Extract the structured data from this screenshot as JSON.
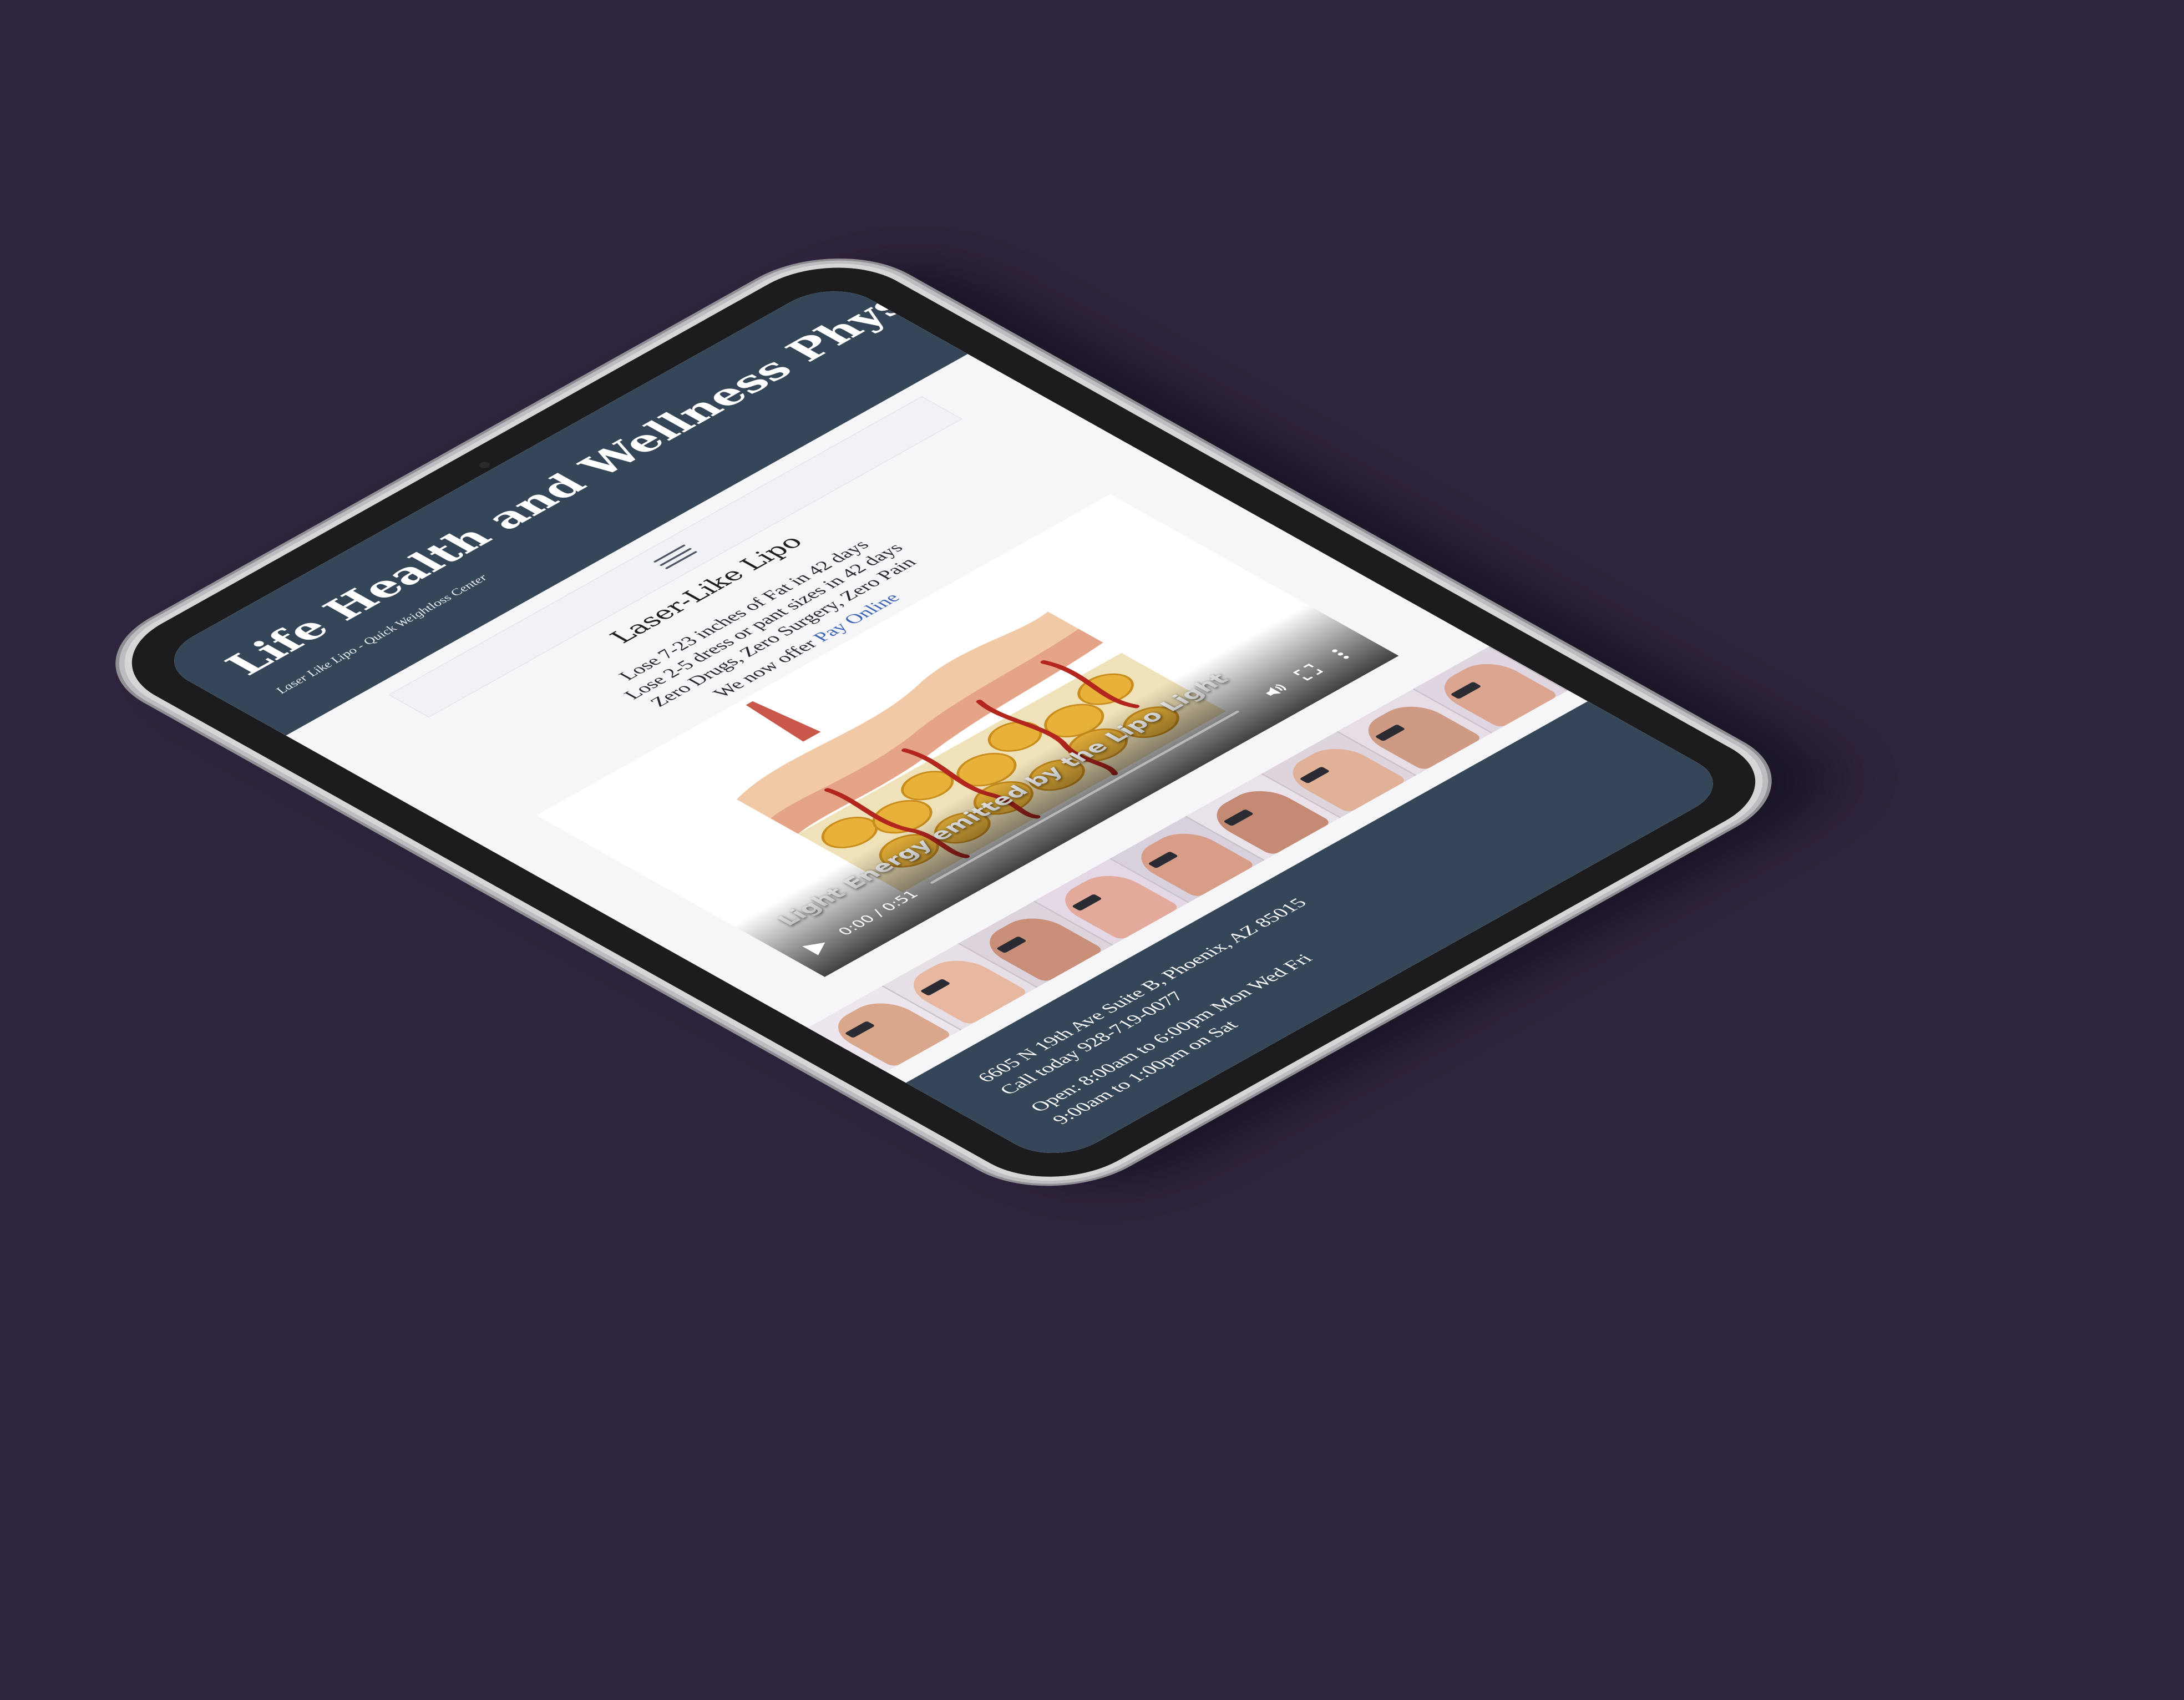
{
  "site": {
    "title": "Life Health and Wellness Physique",
    "tagline": "Laser Like Lipo - Quick Weightloss Center"
  },
  "content": {
    "heading": "Laser-Like Lipo",
    "lines": [
      "Lose 7-23 inches of Fat in 42 days",
      "Lose 2-5 dress or pant sizes in 42 days",
      "Zero Drugs,  Zero Surgery,  Zero Pain"
    ],
    "pay_prefix": "We now offer ",
    "pay_link": "Pay Online"
  },
  "video": {
    "caption": "Light Energy emitted by the Lipo Light",
    "time": "0:00 / 0:51",
    "progress": 0,
    "icons": [
      "play-icon",
      "volume-icon",
      "fullscreen-icon",
      "more-options-icon"
    ]
  },
  "gallery": {
    "thumbnail_count": 9
  },
  "footer": {
    "address": "6605 N 19th Ave Suite B, Phoenix, AZ 85015",
    "phone": "Call today 928-719-0077",
    "hours_weekday": "Open: 8:00am to 6:00pm Mon Wed Fri",
    "hours_saturday": "9:00am to 1:00pm on Sat"
  },
  "colors": {
    "background": "#2e243d",
    "header": "#364659",
    "page": "#f6f6f8",
    "link": "#3a63b8",
    "device_frame": "#d6d6d8",
    "bezel": "#1c1c1e"
  }
}
